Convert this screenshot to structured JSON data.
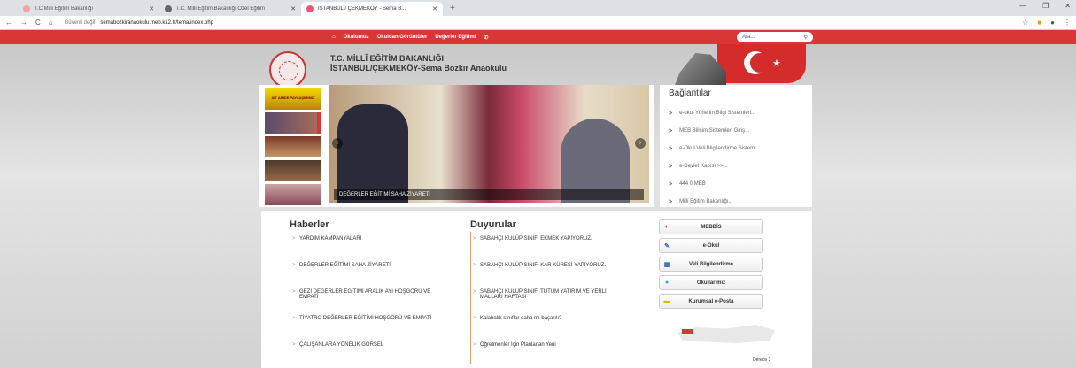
{
  "browser": {
    "tabs": [
      {
        "title": "T.C.Milli Eğitim Bakanlığı",
        "color": "#e88"
      },
      {
        "title": "T.C. Milli Eğitim Bakanlığı Özel Eğitim",
        "color": "#555"
      },
      {
        "title": "İSTANBUL / ÇEKMEKÖY - Sema B...",
        "color": "#e57"
      }
    ],
    "insecure_label": "Güvenli değil",
    "url": "semabozkiranaokulu.meb.k12.tr/tema/index.php"
  },
  "nav": {
    "items": [
      "Okulumuz",
      "Okuldan Görüntüler",
      "Değerler Eğitimi"
    ],
    "search_placeholder": "Ara..."
  },
  "header": {
    "line1": "T.C. MİLLÎ EĞİTİM BAKANLIĞI",
    "line2": "İSTANBUL/ÇEKMEKÖY-Sema Bozkır Anaokulu"
  },
  "slider": {
    "thumb1_text": "AİT ABIDE PAYLAŞIMIMIZ",
    "caption": "DEĞERLER EĞİTİMİ SAHA ZİYARETİ"
  },
  "links": {
    "title": "Bağlantılar",
    "items": [
      "e-okul Yönetim Bilgi Sistemleri...",
      "MEB Bilişim Sistemleri Giriş...",
      "e-Okul Veli Bilgilendirme Sistemi",
      "e-Devlet Kapısı >>...",
      "444 0 MEB",
      "Milli Eğitim Bakanlığı..."
    ]
  },
  "haberler": {
    "title": "Haberler",
    "items": [
      "YARDIM KAMPANYALARI",
      "DEĞERLER EĞİTİMİ SAHA ZİYARETİ",
      "GEZİ DEĞERLER EĞİTİMİ ARALIK AYI HOŞGÖRÜ VE EMPATİ",
      "TİYATRO DEĞERLER EĞİTİMİ HOŞGÖRÜ VE EMPATİ",
      "ÇALIŞANLARA YÖNELİK GÖRSEL"
    ]
  },
  "duyurular": {
    "title": "Duyurular",
    "items": [
      "SABAHÇI KULÜP SINIFI EKMEK YAPIYORUZ.",
      "SABAHÇI KULÜP SINIFI KAR KÜRESİ YAPIYORUZ.",
      "SABAHÇI KULÜP SINIFI TUTUM YATIRIM VE YERLİ MALLARI HAFTASI",
      "Kalabalık sınıflar daha mı başarılı?",
      "Öğretmenler İçin Planlanan Yeni"
    ]
  },
  "quick_buttons": [
    {
      "label": "MEBBİS",
      "icon": "◐"
    },
    {
      "label": "e-Okul",
      "icon": "✎"
    },
    {
      "label": "Veli Bilgilendirme",
      "icon": "▦"
    },
    {
      "label": "Okullarımız",
      "icon": "●"
    },
    {
      "label": "Kurumsal e-Posta",
      "icon": "▬"
    }
  ],
  "weather": {
    "line1": "Derece 3"
  }
}
